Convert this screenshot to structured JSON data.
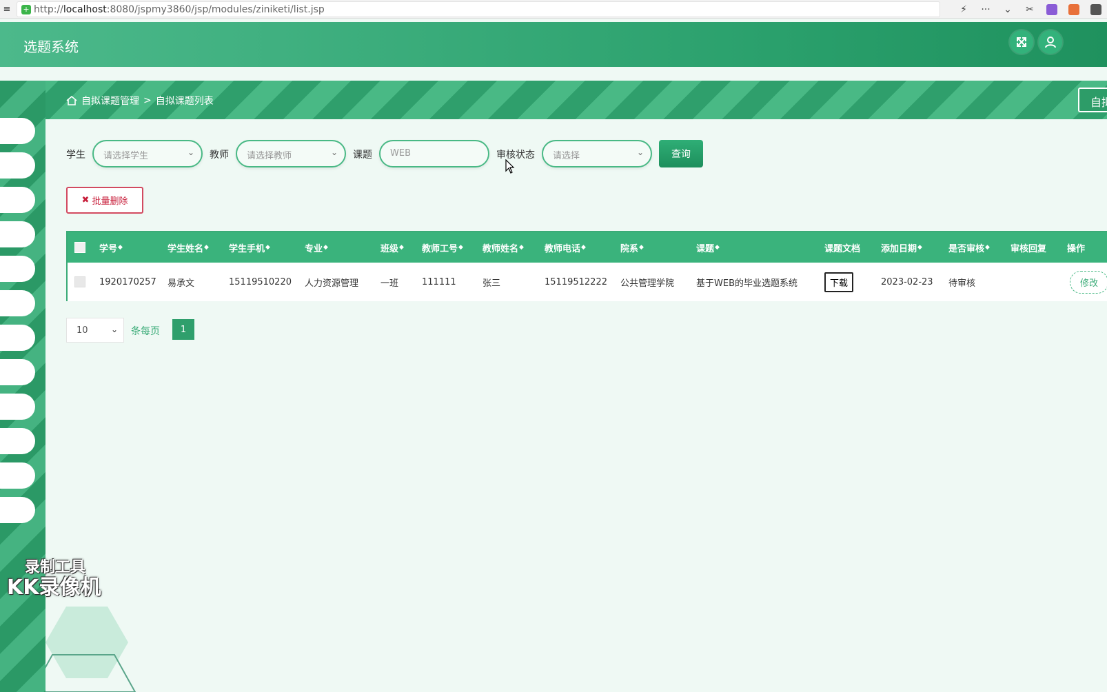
{
  "browser": {
    "url_scheme": "http://",
    "url_host": "localhost",
    "url_rest": ":8080/jspmy3860/jsp/modules/ziniketi/list.jsp"
  },
  "header": {
    "title": "选题系统"
  },
  "breadcrumb": {
    "section": "自拟课题管理",
    "separator": ">",
    "page": "自拟课题列表"
  },
  "right_tab_label": "自拟",
  "filters": {
    "student_label": "学生",
    "student_placeholder": "请选择学生",
    "teacher_label": "教师",
    "teacher_placeholder": "请选择教师",
    "topic_label": "课题",
    "topic_value": "WEB",
    "status_label": "审核状态",
    "status_placeholder": "请选择",
    "query_label": "查询"
  },
  "batch_delete_label": "批量删除",
  "table": {
    "columns": [
      "学号",
      "学生姓名",
      "学生手机",
      "专业",
      "班级",
      "教师工号",
      "教师姓名",
      "教师电话",
      "院系",
      "课题",
      "课题文档",
      "添加日期",
      "是否审核",
      "审核回复",
      "操作"
    ],
    "rows": [
      {
        "student_no": "1920170257",
        "student_name": "易承文",
        "student_phone": "15119510220",
        "major": "人力资源管理",
        "class": "一班",
        "teacher_no": "111111",
        "teacher_name": "张三",
        "teacher_phone": "15119512222",
        "department": "公共管理学院",
        "topic": "基于WEB的毕业选题系统",
        "doc_button": "下载",
        "date": "2023-02-23",
        "status": "待审核",
        "reply": "",
        "edit_button": "修改"
      }
    ]
  },
  "pagination": {
    "page_size": "10",
    "per_page_label": "条每页",
    "current_page": "1"
  },
  "watermark": {
    "line1": "录制工具",
    "line2": "KK录像机"
  }
}
